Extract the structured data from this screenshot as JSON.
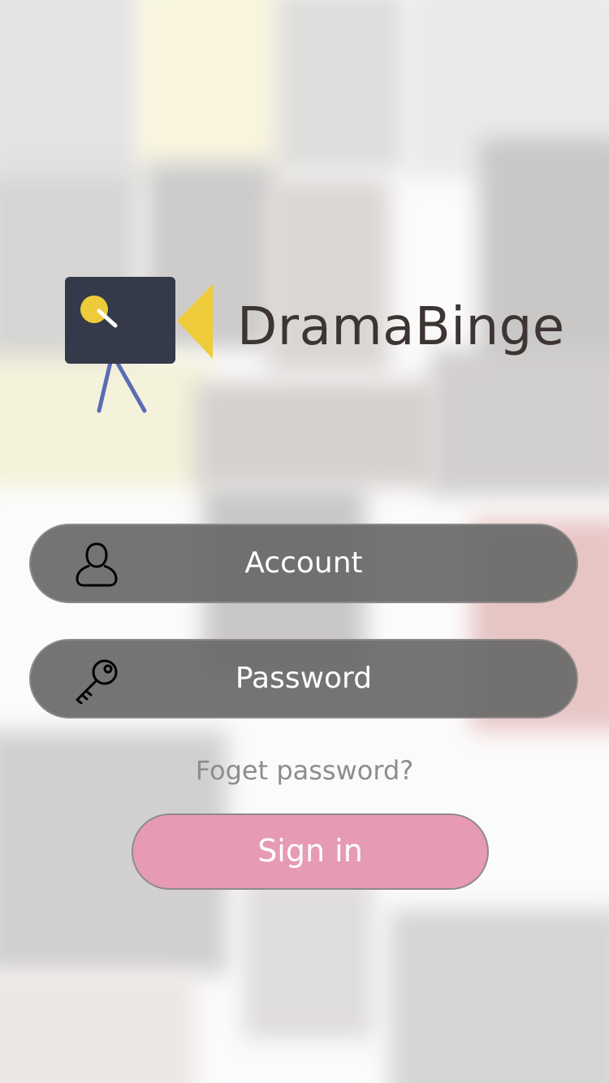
{
  "app": {
    "name": "DramaBinge"
  },
  "login": {
    "account_placeholder": "Account",
    "password_placeholder": "Password",
    "forgot_password": "Foget password?",
    "sign_in": "Sign in"
  },
  "icons": {
    "logo": "video-camera-logo-icon",
    "account": "user-icon",
    "password": "key-icon"
  },
  "colors": {
    "field_bg": "#6b6b6b",
    "signin_bg": "#e69ab4",
    "app_name": "#3d3434",
    "forgot_text": "#8d8d8d",
    "logo_body": "#343a4a",
    "logo_lens": "#eecb3a",
    "logo_legs": "#5b6bb5"
  }
}
